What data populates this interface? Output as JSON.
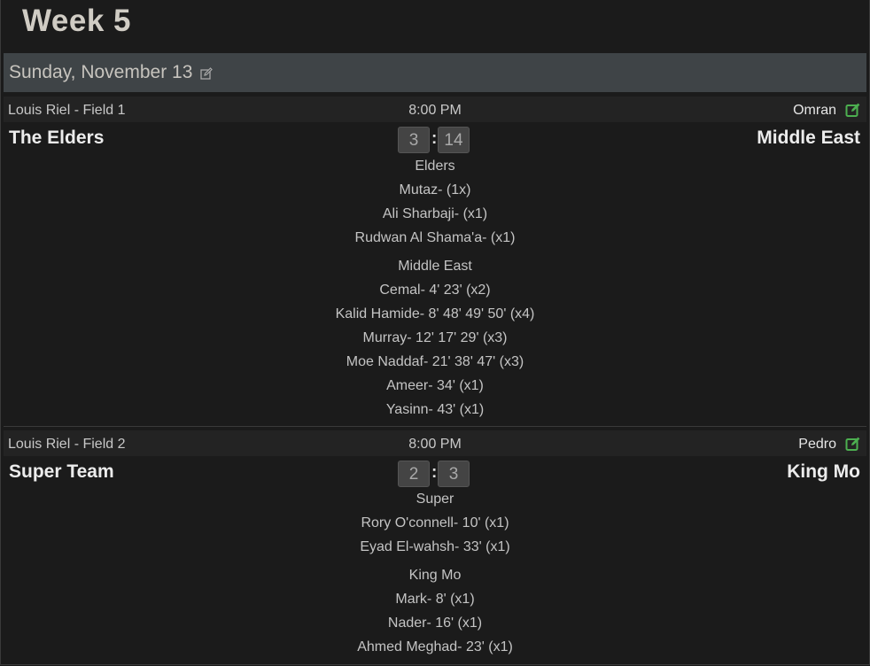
{
  "week": {
    "title": "Week 5"
  },
  "day": {
    "date": "Sunday, November 13"
  },
  "colors": {
    "accent_green": "#4caf50",
    "date_bar": "#3f4447",
    "background": "#1b1b1b"
  },
  "matches": [
    {
      "location": "Louis Riel - Field 1",
      "time": "8:00 PM",
      "referee": "Omran",
      "home_team": "The Elders",
      "away_team": "Middle East",
      "home_score": "3",
      "away_score": "14",
      "score_sep": ":",
      "home_group": {
        "title": "Elders",
        "scorers": [
          "Mutaz- (1x)",
          "Ali Sharbaji- (x1)",
          "Rudwan Al Shama'a- (x1)"
        ]
      },
      "away_group": {
        "title": "Middle East",
        "scorers": [
          "Cemal- 4' 23' (x2)",
          "Kalid Hamide- 8' 48' 49' 50' (x4)",
          "Murray- 12' 17' 29' (x3)",
          "Moe Naddaf- 21' 38' 47' (x3)",
          "Ameer- 34' (x1)",
          "Yasinn- 43' (x1)"
        ]
      }
    },
    {
      "location": "Louis Riel - Field 2",
      "time": "8:00 PM",
      "referee": "Pedro",
      "home_team": "Super Team",
      "away_team": "King Mo",
      "home_score": "2",
      "away_score": "3",
      "score_sep": ":",
      "home_group": {
        "title": "Super",
        "scorers": [
          "Rory O'connell- 10' (x1)",
          "Eyad El-wahsh- 33' (x1)"
        ]
      },
      "away_group": {
        "title": "King Mo",
        "scorers": [
          "Mark- 8' (x1)",
          "Nader- 16' (x1)",
          "Ahmed Meghad- 23' (x1)"
        ]
      }
    }
  ]
}
